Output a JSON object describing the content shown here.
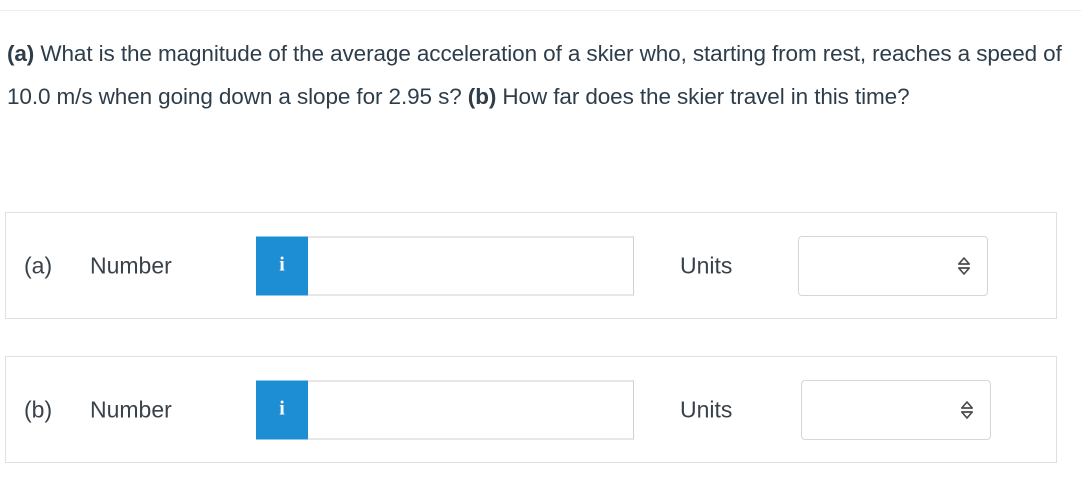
{
  "question": {
    "part_a_tag": "(a)",
    "part_a_text": " What is the magnitude of the average acceleration of a skier who, starting from rest, reaches a speed of 10.0 m/s when going down a slope for 2.95 s? ",
    "part_b_tag": "(b)",
    "part_b_text": " How far does the skier travel in this time?"
  },
  "answers": [
    {
      "part_label": "(a)",
      "number_label": "Number",
      "info_icon_glyph": "i",
      "input_value": "",
      "input_placeholder": "",
      "units_label": "Units",
      "units_value": "",
      "units_options": [
        ""
      ]
    },
    {
      "part_label": "(b)",
      "number_label": "Number",
      "info_icon_glyph": "i",
      "input_value": "",
      "input_placeholder": "",
      "units_label": "Units",
      "units_value": "",
      "units_options": [
        ""
      ]
    }
  ],
  "colors": {
    "info_badge_blue": "#1d8ed4",
    "text": "#2e3d4a",
    "card_border": "#e0e0e0",
    "input_border": "#cfcfcf",
    "select_border": "#d6d6d6",
    "divider": "#ececec"
  }
}
